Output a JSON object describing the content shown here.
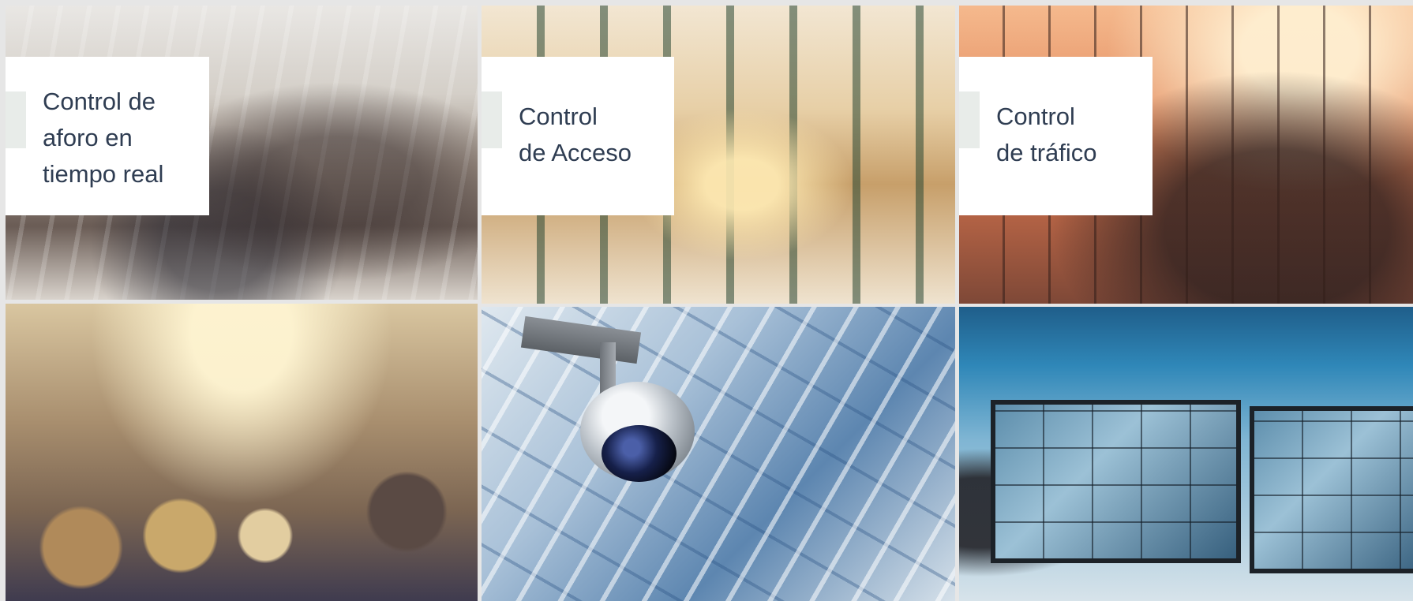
{
  "tiles": [
    {
      "name": "mall-crowd-photo",
      "label": "Control de\naforo en\ntiempo real"
    },
    {
      "name": "escalator-atrium-photo",
      "label": "Control\nde Acceso"
    },
    {
      "name": "road-traffic-photo",
      "label": "Control\nde tráfico"
    },
    {
      "name": "street-crowd-photo"
    },
    {
      "name": "security-camera-photo"
    },
    {
      "name": "control-room-photo"
    }
  ],
  "colors": {
    "label_text": "#2f3d52",
    "card_background": "#ffffff",
    "accent_bar": "#e8ece9",
    "page_background": "#e6e6e6"
  },
  "icons": [
    "security-camera-icon"
  ]
}
